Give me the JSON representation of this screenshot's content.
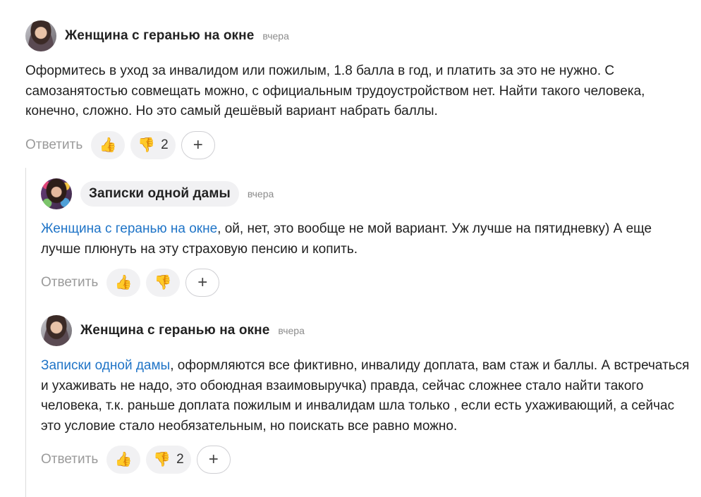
{
  "comments": [
    {
      "author": "Женщина с геранью на окне",
      "time": "вчера",
      "mention": "",
      "text": "Оформитесь в уход за инвалидом или пожилым, 1.8 балла в год, и платить за это не нужно. С самозанятостью совмещать можно, с официальным трудоустройством нет. Найти такого человека, конечно, сложно. Но это самый дешёвый вариант набрать баллы.",
      "reply_label": "Ответить",
      "like_emoji": "👍",
      "dislike_emoji": "👎",
      "dislike_count": "2",
      "add_label": "+"
    },
    {
      "author": "Записки одной дамы",
      "time": "вчера",
      "mention": "Женщина с геранью на окне",
      "text": ", ой, нет, это вообще не мой вариант. Уж лучше на пятидневку) А еще лучше плюнуть на эту страховую пенсию и копить.",
      "reply_label": "Ответить",
      "like_emoji": "👍",
      "dislike_emoji": "👎",
      "dislike_count": "",
      "add_label": "+"
    },
    {
      "author": "Женщина с геранью на окне",
      "time": "вчера",
      "mention": "Записки одной дамы",
      "text": ", оформляются все фиктивно, инвалиду доплата, вам стаж и баллы. А встречаться и ухаживать не надо, это обоюдная взаимовыручка) правда, сейчас сложнее стало найти такого человека, т.к. раньше доплата пожилым и инвалидам шла только , если есть ухаживающий, а сейчас это условие стало необязательным, но поискать все равно можно.",
      "reply_label": "Ответить",
      "like_emoji": "👍",
      "dislike_emoji": "👎",
      "dislike_count": "2",
      "add_label": "+"
    }
  ],
  "colors": {
    "link": "#1f74c7",
    "muted": "#9a9a9a",
    "pill_bg": "#f1f1f3"
  }
}
